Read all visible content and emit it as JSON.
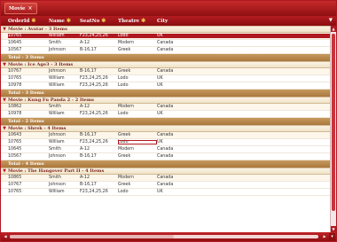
{
  "groupby": {
    "chip_label": "Movie",
    "remove_glyph": "×"
  },
  "header": {
    "columns": [
      "OrderId",
      "Name",
      "SeatNo",
      "Theatre",
      "City"
    ],
    "icon": "gear-icon",
    "filter_glyph": "▼"
  },
  "groups": [
    {
      "title": "Movie : Avatar - 3 Items",
      "rows": [
        {
          "orderid": "10765",
          "name": "William",
          "seat": "F23,24,25,26",
          "theatre": "Lodo",
          "city": "UK",
          "selected": true
        },
        {
          "orderid": "10645",
          "name": "Smith",
          "seat": "A-12",
          "theatre": "Modern",
          "city": "Canada"
        },
        {
          "orderid": "10567",
          "name": "Johnson",
          "seat": "B-16,17",
          "theatre": "Greek",
          "city": "Canada"
        }
      ],
      "total": "Total - 3 Items"
    },
    {
      "title": "Movie : Ice Age3 - 3 Items",
      "rows": [
        {
          "orderid": "10767",
          "name": "Johnson",
          "seat": "B-16,17",
          "theatre": "Greek",
          "city": "Canada"
        },
        {
          "orderid": "10765",
          "name": "William",
          "seat": "F23,24,25,26",
          "theatre": "Lodo",
          "city": "UK"
        },
        {
          "orderid": "10978",
          "name": "William",
          "seat": "F23,24,25,26",
          "theatre": "Lodo",
          "city": "UK"
        }
      ],
      "total": "Total - 3 Items"
    },
    {
      "title": "Movie : Kung Fu Panda 2 - 2 Items",
      "rows": [
        {
          "orderid": "10862",
          "name": "Smith",
          "seat": "A-12",
          "theatre": "Modern",
          "city": "Canada"
        },
        {
          "orderid": "10978",
          "name": "William",
          "seat": "F23,24,25,26",
          "theatre": "Lodo",
          "city": "UK"
        }
      ],
      "total": "Total - 2 Items"
    },
    {
      "title": "Movie : Shrek - 4 Items",
      "rows": [
        {
          "orderid": "10643",
          "name": "Johnson",
          "seat": "B-16,17",
          "theatre": "Greek",
          "city": "Canada"
        },
        {
          "orderid": "10765",
          "name": "William",
          "seat": "F23,24,25,26",
          "theatre": "Lodo",
          "city": "UK",
          "boxed": true
        },
        {
          "orderid": "10645",
          "name": "Smith",
          "seat": "A-12",
          "theatre": "Modern",
          "city": "Canada"
        },
        {
          "orderid": "10567",
          "name": "Johnson",
          "seat": "B-16,17",
          "theatre": "Greek",
          "city": "Canada"
        }
      ],
      "total": "Total - 4 Items"
    },
    {
      "title": "Movie : The Hangover Part II - 4 Items",
      "rows": [
        {
          "orderid": "10865",
          "name": "Smith",
          "seat": "A-12",
          "theatre": "Modern",
          "city": "Canada"
        },
        {
          "orderid": "10767",
          "name": "Johnson",
          "seat": "B-16,17",
          "theatre": "Greek",
          "city": "Canada"
        },
        {
          "orderid": "10765",
          "name": "William",
          "seat": "F23,24,25,26",
          "theatre": "Lodo",
          "city": "UK"
        }
      ],
      "total": ""
    }
  ],
  "colors": {
    "primary": "#b01820",
    "group_bg": "#f0e3c8",
    "total_bg": "#b88a4e",
    "icon": "#f0c24a"
  }
}
